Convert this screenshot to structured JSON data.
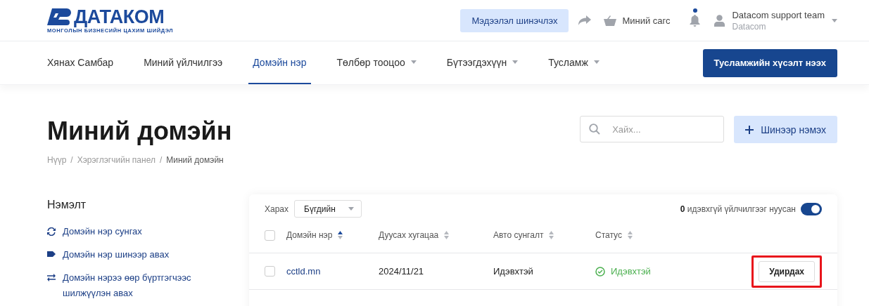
{
  "header": {
    "logo": {
      "name": "ДАТАКОМ",
      "tagline": "МОНГОЛЫН БИЗНЕСИЙН ЦАХИМ ШИЙДЭЛ"
    },
    "update_button": "Мэдээлэл шинэчлэх",
    "cart": "Миний сагс",
    "notifications": {
      "unread": true
    },
    "user": {
      "name": "Datacom support team",
      "org": "Datacom"
    }
  },
  "nav": {
    "items": [
      {
        "label": "Хянах Самбар",
        "selected": false,
        "dropdown": false
      },
      {
        "label": "Миний үйлчилгээ",
        "selected": false,
        "dropdown": false
      },
      {
        "label": "Домэйн нэр",
        "selected": true,
        "dropdown": false
      },
      {
        "label": "Төлбөр тооцоо",
        "selected": false,
        "dropdown": true
      },
      {
        "label": "Бүтээгдэхүүн",
        "selected": false,
        "dropdown": true
      },
      {
        "label": "Тусламж",
        "selected": false,
        "dropdown": true
      }
    ],
    "support_button": "Тусламжийн хүсэлт нээх"
  },
  "page": {
    "title": "Миний домэйн",
    "breadcrumbs": [
      {
        "kind": "link",
        "text": "Нүүр"
      },
      {
        "kind": "separator",
        "text": "/"
      },
      {
        "kind": "link",
        "text": "Хэрэглэгчийн панел"
      },
      {
        "kind": "separator",
        "text": "/"
      },
      {
        "kind": "current",
        "text": "Миний домэйн"
      }
    ],
    "search": {
      "placeholder": "Хайх..."
    },
    "add_button": "Шинээр нэмэх"
  },
  "sidebar": {
    "title": "Нэмэлт",
    "items": [
      {
        "kind": "renew",
        "label": "Домэйн нэр сунгах"
      },
      {
        "kind": "tag",
        "label": "Домэйн нэр шинээр авах"
      },
      {
        "kind": "transfer",
        "label": "Домэйн нэрээ өөр бүртгэгчээс шилжүүлэн авах"
      }
    ]
  },
  "table": {
    "filter_label": "Харах",
    "filter_value": "Бүгдийн",
    "hidden_count": "0",
    "hidden_label": "идэвхгүй үйлчилгээг нуусан",
    "hide_inactive": true,
    "select_all": {
      "checked": false
    },
    "columns": [
      {
        "label": "Домэйн нэр",
        "sorted": true
      },
      {
        "label": "Дуусах хугацаа",
        "sorted": false
      },
      {
        "label": "Авто сунгалт",
        "sorted": false
      },
      {
        "label": "Статус",
        "sorted": false
      }
    ],
    "rows": [
      {
        "checked": false,
        "domain": "cctld.mn",
        "expires": "2024/11/21",
        "auto_renew": "Идэвхтэй",
        "status": "Идэвхтэй",
        "active": true,
        "action": "Удирдах",
        "highlighted": true
      }
    ]
  }
}
